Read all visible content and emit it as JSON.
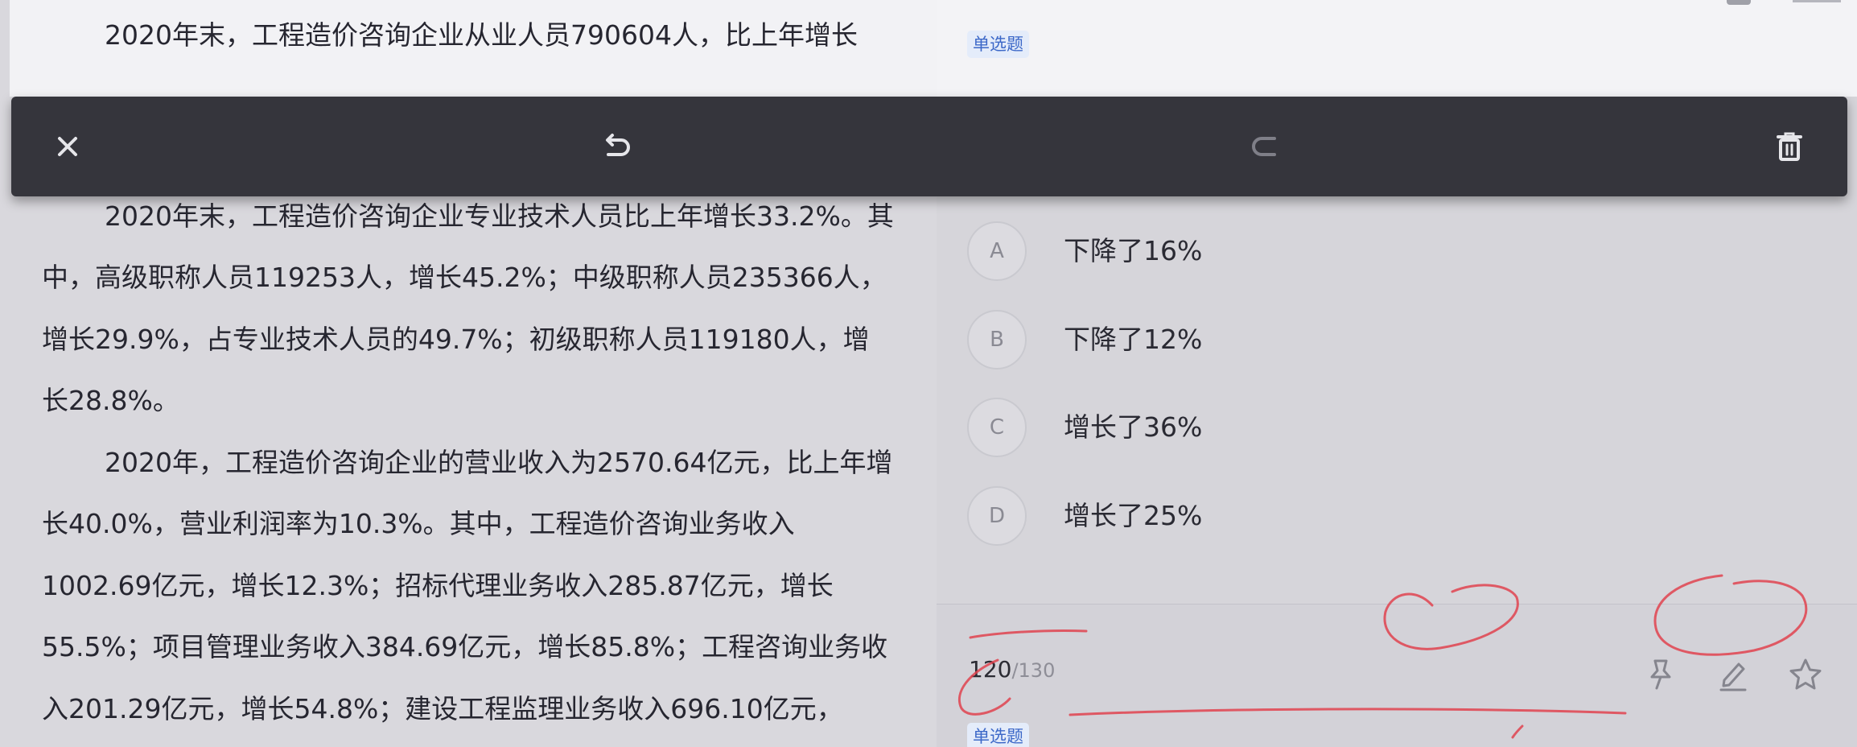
{
  "passage": {
    "para1_line1": "2020年末，工程造价咨询企业从业人员790604人，比上年增长",
    "para2": "2020年末，工程造价咨询企业专业技术人员比上年增长33.2%。其中，高级职称人员119253人，增长45.2%；中级职称人员235366人，增长29.9%，占专业技术人员的49.7%；初级职称人员119180人，增长28.8%。",
    "para3": "2020年，工程造价咨询企业的营业收入为2570.64亿元，比上年增长40.0%，营业利润率为10.3%。其中，工程造价咨询业务收入1002.69亿元，增长12.3%；招标代理业务收入285.87亿元，增长55.5%；项目管理业务收入384.69亿元，增长85.8%；工程咨询业务收入201.29亿元，增长54.8%；建设工程监理业务收入696.10亿元，"
  },
  "question": {
    "type_tag": "单选题",
    "options": [
      {
        "letter": "A",
        "text": "下降了16%"
      },
      {
        "letter": "B",
        "text": "下降了12%"
      },
      {
        "letter": "C",
        "text": "增长了36%"
      },
      {
        "letter": "D",
        "text": "增长了25%"
      }
    ]
  },
  "bottom": {
    "current": "120",
    "total": "/130",
    "next_type_tag": "单选题"
  },
  "toolbar": {
    "icons": [
      "close-icon",
      "undo-icon",
      "eraser-icon",
      "trash-icon"
    ]
  },
  "bottom_icons": [
    "pin-icon",
    "pencil-icon",
    "star-icon"
  ],
  "colors": {
    "toolbar_bg": "#35353c",
    "tag_text": "#3c68c8",
    "tag_bg": "#e4ecfa",
    "ink_red": "#e0434f"
  }
}
